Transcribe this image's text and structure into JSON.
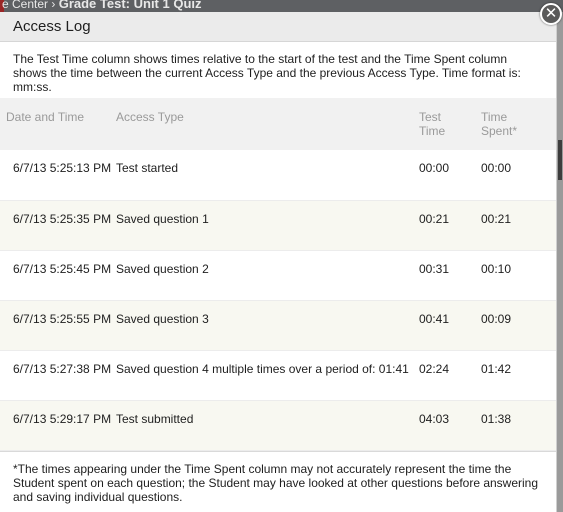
{
  "background": {
    "breadcrumb_prefix": "e Center",
    "breadcrumb_sep": "›",
    "breadcrumb_current": "Grade Test: Unit 1 Quiz"
  },
  "dialog": {
    "title": "Access Log",
    "close_symbol": "✕",
    "intro": "The Test Time column shows times relative to the start of the test and the Time Spent column shows the time between the current Access Type and the previous Access Type. Time format is: mm:ss."
  },
  "table": {
    "headers": {
      "date": "Date and Time",
      "type": "Access Type",
      "test_time_line1": "Test",
      "test_time_line2": "Time",
      "spent_line1": "Time",
      "spent_line2": "Spent*"
    },
    "rows": [
      {
        "date": "6/7/13 5:25:13 PM",
        "type": "Test started",
        "test_time": "00:00",
        "spent": "00:00"
      },
      {
        "date": "6/7/13 5:25:35 PM",
        "type": "Saved question 1",
        "test_time": "00:21",
        "spent": "00:21"
      },
      {
        "date": "6/7/13 5:25:45 PM",
        "type": "Saved question 2",
        "test_time": "00:31",
        "spent": "00:10"
      },
      {
        "date": "6/7/13 5:25:55 PM",
        "type": "Saved question 3",
        "test_time": "00:41",
        "spent": "00:09"
      },
      {
        "date": "6/7/13 5:27:38 PM",
        "type": "Saved question 4 multiple times over a period of: 01:41",
        "test_time": "02:24",
        "spent": "01:42"
      },
      {
        "date": "6/7/13 5:29:17 PM",
        "type": "Test submitted",
        "test_time": "04:03",
        "spent": "01:38"
      }
    ]
  },
  "footnote": "*The times appearing under the Time Spent column may not accurately represent the time the Student spent on each question; the Student may have looked at other questions before answering and saving individual questions.",
  "colors": {
    "header_bg": "#ebebeb",
    "alt_row_bg": "#f8f8f1",
    "muted_header_text": "#9a9a9a"
  }
}
